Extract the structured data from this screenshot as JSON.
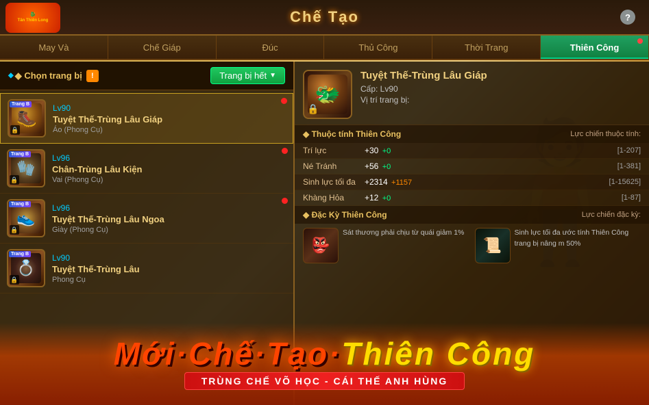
{
  "header": {
    "title": "Chế Tạo",
    "help_label": "?",
    "logo_text": "Tân Thiên Long"
  },
  "tabs": [
    {
      "id": "may-va",
      "label": "May Và",
      "active": false
    },
    {
      "id": "che-giap",
      "label": "Chế Giáp",
      "active": false
    },
    {
      "id": "duc",
      "label": "Đúc",
      "active": false
    },
    {
      "id": "thu-cong",
      "label": "Thủ Công",
      "active": false
    },
    {
      "id": "thoi-trang",
      "label": "Thời Trang",
      "active": false
    },
    {
      "id": "thien-cong",
      "label": "Thiên Công",
      "active": true
    }
  ],
  "left_panel": {
    "section_title": "◆ Chọn trang bị",
    "filter_button": "Trang bị hết",
    "items": [
      {
        "level": "Lv90",
        "name": "Tuyệt Thế-Trùng Lâu Giáp",
        "type": "Áo (Phong Cụ)",
        "selected": true,
        "badge": "Trang B",
        "has_red_dot": true
      },
      {
        "level": "Lv96",
        "name": "Chân-Trùng Lâu Kiện",
        "type": "Vai (Phong Cụ)",
        "selected": false,
        "badge": "Trang B",
        "has_red_dot": true
      },
      {
        "level": "Lv96",
        "name": "Tuyệt Thế-Trùng Lâu Ngoa",
        "type": "Giày (Phong Cụ)",
        "selected": false,
        "badge": "Trang B",
        "has_red_dot": true
      },
      {
        "level": "Lv90",
        "name": "Tuyệt Thế-Trùng Lâu",
        "type": "Phong Cụ",
        "selected": false,
        "badge": "Trang B",
        "has_red_dot": false
      }
    ]
  },
  "right_panel": {
    "item_name": "Tuyệt Thế-Trùng Lâu Giáp",
    "item_level": "Cấp: Lv90",
    "item_position": "Vị trí trang bị:",
    "thuoc_tinh_title": "◆ Thuộc tính Thiên Công",
    "luc_chien_title": "Lực chiến thuộc tính:",
    "stats": [
      {
        "name": "Trí lực",
        "value": "+30",
        "plus": "+0",
        "range": "[1-207]"
      },
      {
        "name": "Né Tránh",
        "value": "+56",
        "plus": "+0",
        "range": "[1-381]"
      },
      {
        "name": "Sinh lực tối đa",
        "value": "+2314",
        "plus": "+1157",
        "range": "[1-15625]"
      },
      {
        "name": "Khàng Hỏa",
        "value": "+12",
        "plus": "+0",
        "range": "[1-87]"
      }
    ],
    "dac_ky_title": "◆ Đặc Kỳ Thiên Công",
    "dac_ky_sub": "Lực chiến đặc kỳ:",
    "special_1_text": "Sát thương phải chịu từ quái giảm 1%",
    "special_2_text": "Sinh lực tối đa ước tính Thiên Công trang bị nâng m 50%"
  },
  "banner": {
    "main_text_1": "Mới Chế Tạo",
    "main_text_2": " Thiên Công",
    "sub_text": "TRÙNG CHẾ VÕ HỌC - CÁI THẾ ANH HÙNG"
  }
}
